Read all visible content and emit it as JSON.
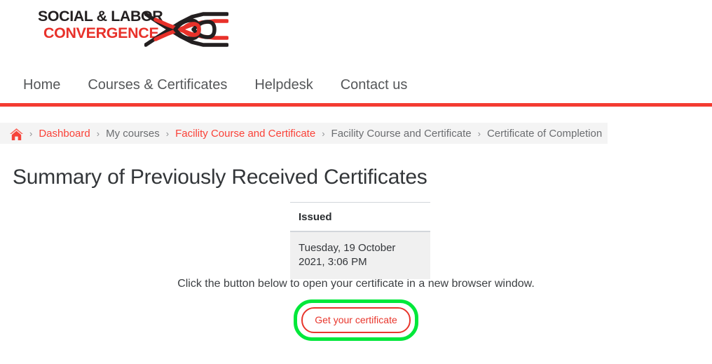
{
  "header": {
    "logo": {
      "line1": "SOCIAL & LABOR",
      "line2": "CONVERGENCE",
      "knot_icon": "woven-rope-knot-icon",
      "black": "#231f20",
      "red": "#e8312a"
    }
  },
  "nav": {
    "items": [
      {
        "label": "Home",
        "name": "nav-item-home"
      },
      {
        "label": "Courses & Certificates",
        "name": "nav-item-courses-certificates"
      },
      {
        "label": "Helpdesk",
        "name": "nav-item-helpdesk"
      },
      {
        "label": "Contact us",
        "name": "nav-item-contact-us"
      }
    ],
    "rule_color": "#f43b31"
  },
  "breadcrumb": {
    "home_icon": "home-icon",
    "separator": "›",
    "items": [
      {
        "label": "Dashboard",
        "link": true
      },
      {
        "label": "My courses",
        "link": false
      },
      {
        "label": "Facility Course and Certificate",
        "link": true
      },
      {
        "label": "Facility Course and Certificate",
        "link": false
      },
      {
        "label": "Certificate of Completion",
        "link": false
      }
    ]
  },
  "main": {
    "page_title": "Summary of Previously Received Certificates",
    "table": {
      "columns": [
        "Issued"
      ],
      "rows": [
        [
          "Tuesday, 19 October 2021, 3:06 PM"
        ]
      ]
    },
    "instruction": "Click the button below to open your certificate in a new browser window.",
    "button": {
      "label": "Get your certificate",
      "border_color": "#e8362c",
      "text_color": "#e8362c",
      "highlight_color": "#00e83a"
    }
  }
}
